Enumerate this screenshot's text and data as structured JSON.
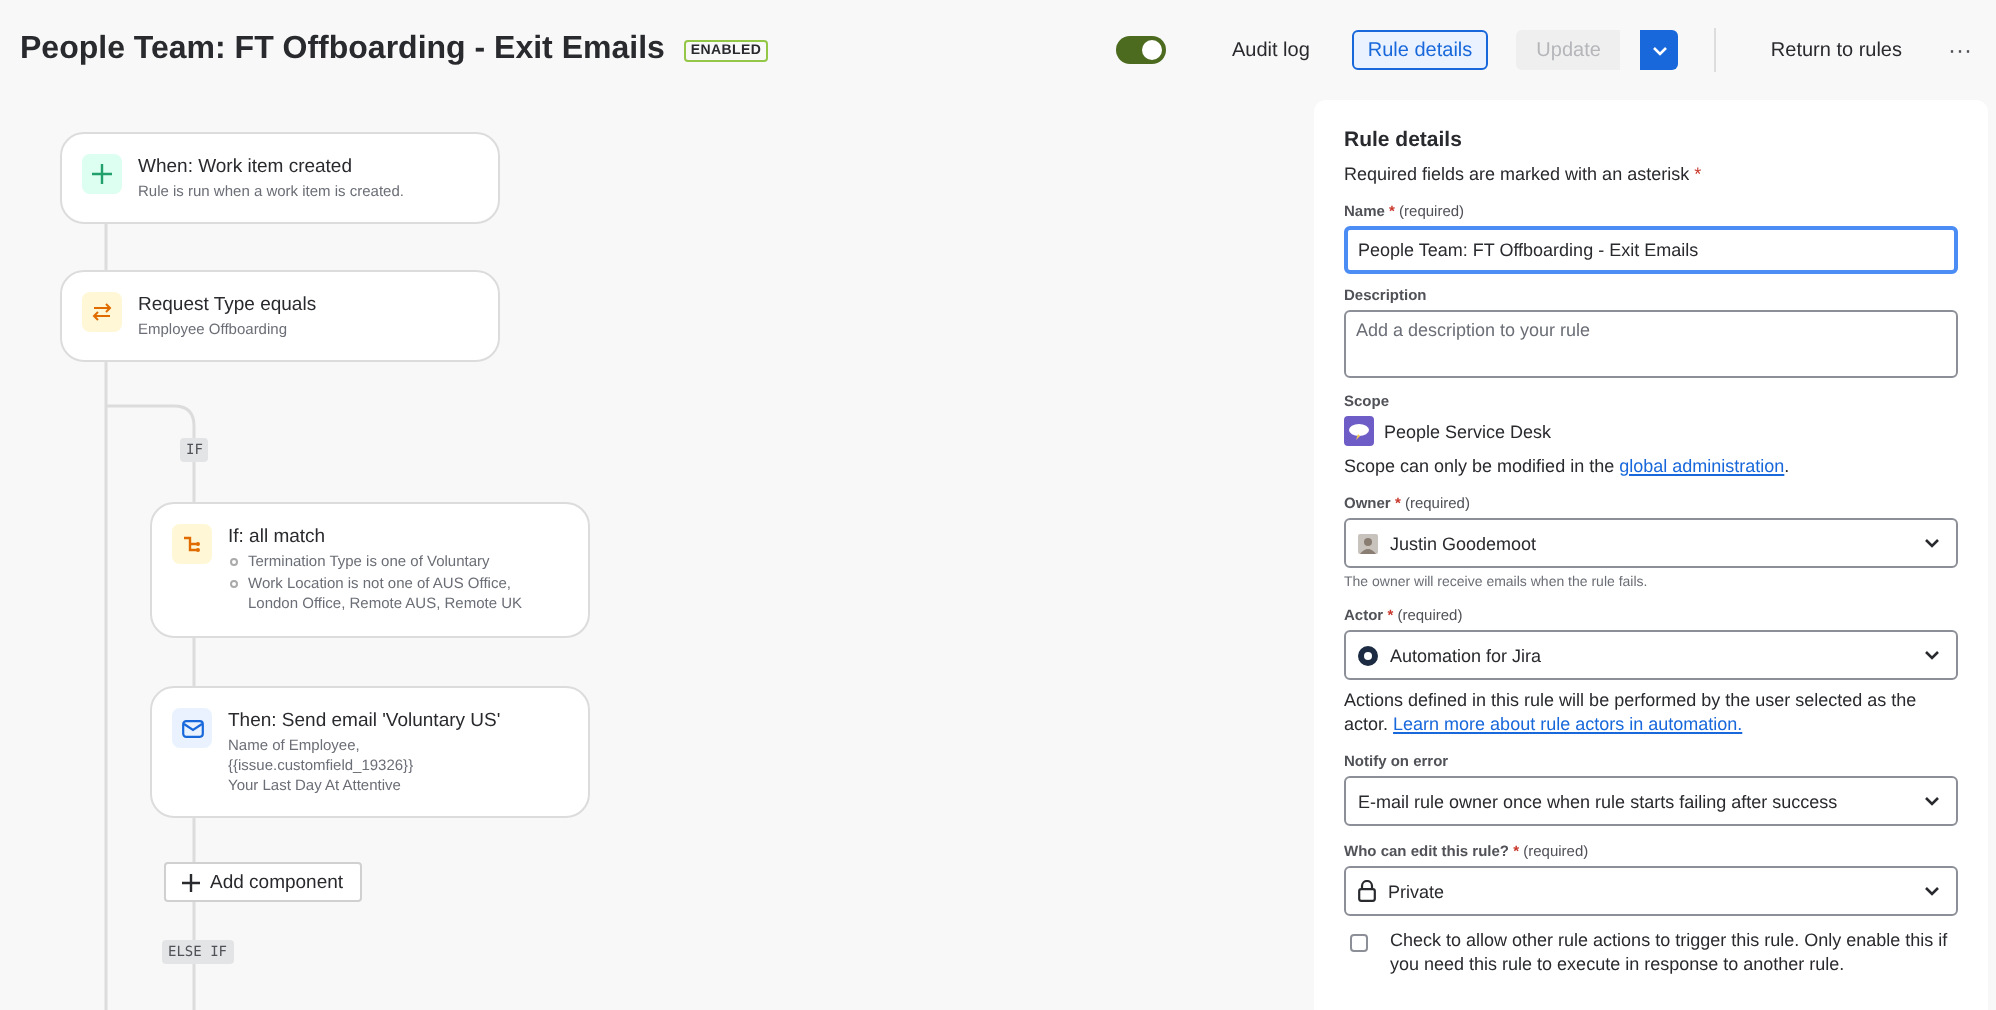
{
  "header": {
    "title": "People Team: FT Offboarding - Exit Emails",
    "status_badge": "ENABLED",
    "enabled_toggle": {
      "on": true
    },
    "actions": [
      {
        "kind": "link",
        "label": "Audit log"
      },
      {
        "kind": "outline",
        "label": "Rule details",
        "selected": true
      },
      {
        "kind": "disabled",
        "label": "Update"
      },
      {
        "kind": "split"
      },
      {
        "kind": "link",
        "label": "Return to rules"
      },
      {
        "kind": "more",
        "label": "···"
      }
    ]
  },
  "flow": {
    "nodes": [
      {
        "kind": "trigger",
        "title": "When: Work item created",
        "subtitle": "Rule is run when a work item is created."
      },
      {
        "kind": "condition",
        "title": "Request Type equals",
        "subtitle": "Employee Offboarding"
      }
    ],
    "branches": [
      {
        "label": "IF",
        "nodes": [
          {
            "kind": "if",
            "title": "If: all match",
            "conditions": [
              "Termination Type is one of Voluntary",
              "Work Location is not one of AUS Office, London Office, Remote AUS, Remote UK"
            ]
          },
          {
            "kind": "email",
            "title": "Then: Send email 'Voluntary US'",
            "lines": [
              "Name of Employee,",
              "{{issue.customfield_19326}}",
              "Your Last Day At Attentive"
            ]
          }
        ],
        "add_button": "Add component"
      },
      {
        "label": "ELSE IF"
      }
    ]
  },
  "rule_details": {
    "title": "Rule details",
    "required_note": "Required fields are marked with an asterisk",
    "required_mark": "*",
    "name": {
      "label": "Name",
      "mark": "*",
      "hint": "(required)",
      "value": "People Team: FT Offboarding - Exit Emails",
      "focused": true
    },
    "description": {
      "label": "Description",
      "placeholder": "Add a description to your rule"
    },
    "scope": {
      "label": "Scope",
      "value": "People Service Desk",
      "note": "Scope can only be modified in the",
      "link": "global administration",
      "after": "."
    },
    "owner": {
      "label": "Owner",
      "mark": "*",
      "hint": "(required)",
      "value": "Justin Goodemoot",
      "help": "The owner will receive emails when the rule fails."
    },
    "actor": {
      "label": "Actor",
      "mark": "*",
      "hint": "(required)",
      "value": "Automation for Jira",
      "help": "Actions defined in this rule will be performed by the user selected as the actor.",
      "link": "Learn more about rule actors in automation."
    },
    "notify": {
      "label": "Notify on error",
      "value": "E-mail rule owner once when rule starts failing after success"
    },
    "editors": {
      "label": "Who can edit this rule?",
      "mark": "*",
      "hint": "(required)",
      "value": "Private"
    },
    "allow_trigger": {
      "checked": false,
      "label": "Check to allow other rule actions to trigger this rule. Only enable this if you need this rule to execute in response to another rule."
    }
  }
}
